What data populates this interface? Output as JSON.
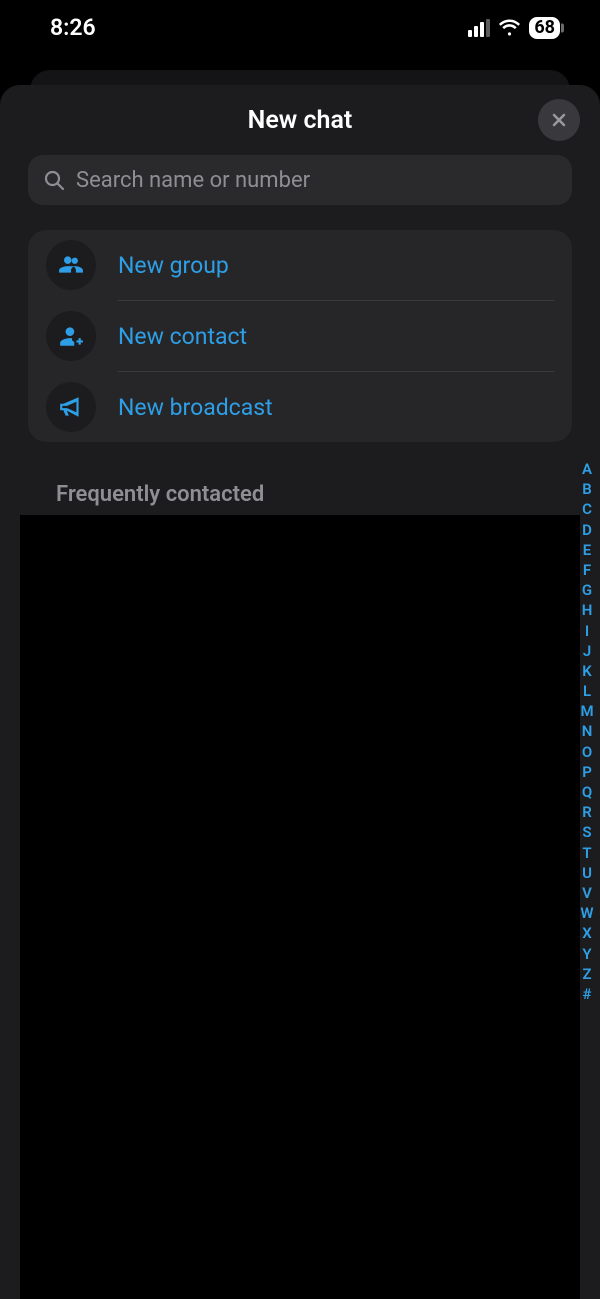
{
  "status": {
    "time": "8:26",
    "battery": "68"
  },
  "sheet": {
    "title": "New chat"
  },
  "search": {
    "placeholder": "Search name or number"
  },
  "actions": {
    "new_group": "New group",
    "new_contact": "New contact",
    "new_broadcast": "New broadcast"
  },
  "section": {
    "frequently_contacted": "Frequently contacted"
  },
  "alpha_index": [
    "A",
    "B",
    "C",
    "D",
    "E",
    "F",
    "G",
    "H",
    "I",
    "J",
    "K",
    "L",
    "M",
    "N",
    "O",
    "P",
    "Q",
    "R",
    "S",
    "T",
    "U",
    "V",
    "W",
    "X",
    "Y",
    "Z",
    "#"
  ],
  "colors": {
    "accent": "#2e9fe6",
    "sheet_bg": "#1c1c1e",
    "card_bg": "#262628",
    "search_bg": "#2a2a2c",
    "muted": "#8e8e93"
  }
}
